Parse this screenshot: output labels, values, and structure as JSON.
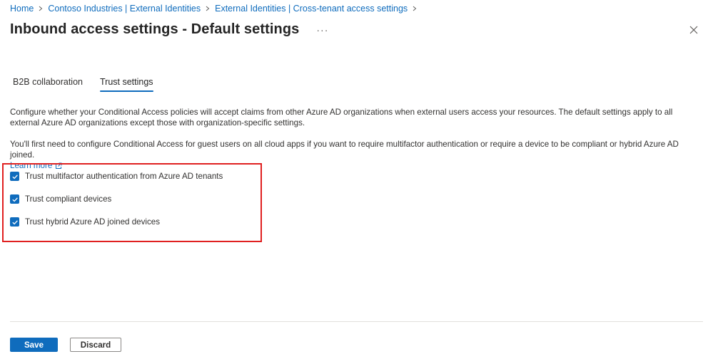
{
  "breadcrumb": {
    "items": [
      {
        "label": "Home"
      },
      {
        "label": "Contoso Industries | External Identities"
      },
      {
        "label": "External Identities | Cross-tenant access settings"
      }
    ]
  },
  "header": {
    "title": "Inbound access settings - Default settings",
    "more_label": "···",
    "close_icon": "close-icon"
  },
  "tabs": [
    {
      "label": "B2B collaboration",
      "active": false
    },
    {
      "label": "Trust settings",
      "active": true
    }
  ],
  "content": {
    "description": "Configure whether your Conditional Access policies will accept claims from other Azure AD organizations when external users access your resources. The default settings apply to all external Azure AD organizations except those with organization-specific settings.",
    "note": "You'll first need to configure Conditional Access for guest users on all cloud apps if you want to require multifactor authentication or require a device to be compliant or hybrid Azure AD joined.",
    "learn_more_label": "Learn more",
    "external_link_icon": "external-link-icon"
  },
  "trust_options": [
    {
      "label": "Trust multifactor authentication from Azure AD tenants",
      "checked": true
    },
    {
      "label": "Trust compliant devices",
      "checked": true
    },
    {
      "label": "Trust hybrid Azure AD joined devices",
      "checked": true
    }
  ],
  "footer": {
    "save_label": "Save",
    "discard_label": "Discard"
  },
  "colors": {
    "accent": "#0f6cbd",
    "highlight": "#e02020",
    "text": "#323130"
  }
}
